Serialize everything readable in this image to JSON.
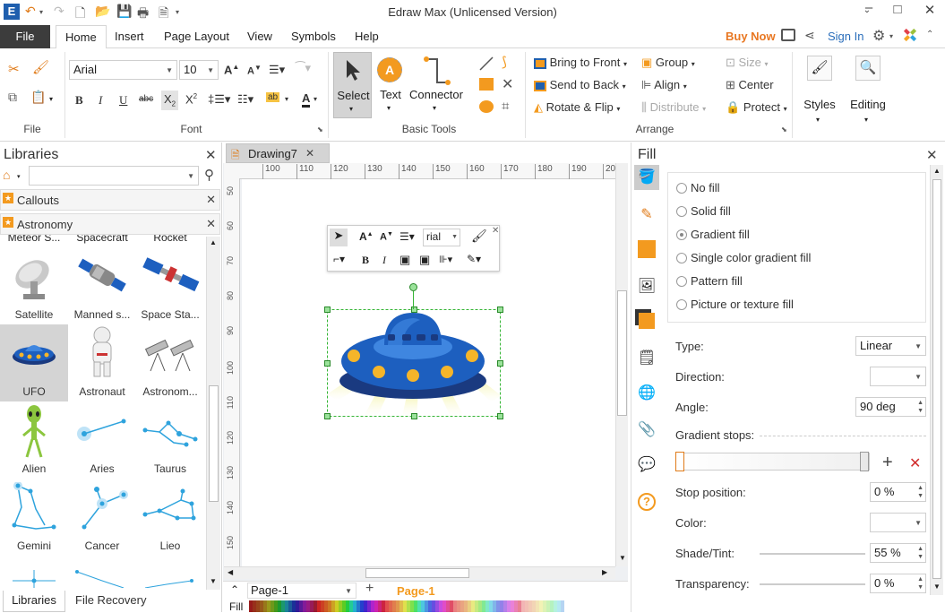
{
  "app": {
    "title": "Edraw Max (Unlicensed Version)"
  },
  "tabs": [
    "File",
    "Home",
    "Insert",
    "Page Layout",
    "View",
    "Symbols",
    "Help"
  ],
  "header_right": {
    "buy_now": "Buy Now",
    "sign_in": "Sign In"
  },
  "font": {
    "name": "Arial",
    "size": "10"
  },
  "groups": {
    "file": "File",
    "font": "Font",
    "basic_tools": "Basic Tools",
    "arrange": "Arrange"
  },
  "tools": {
    "select": "Select",
    "text": "Text",
    "connector": "Connector"
  },
  "arrange": {
    "bring_to_front": "Bring to Front",
    "send_to_back": "Send to Back",
    "rotate_flip": "Rotate & Flip",
    "group": "Group",
    "align": "Align",
    "distribute": "Distribute",
    "size": "Size",
    "center": "Center",
    "protect": "Protect"
  },
  "styles_label": "Styles",
  "editing_label": "Editing",
  "libraries": {
    "title": "Libraries",
    "rows": [
      "Callouts",
      "Astronomy"
    ],
    "partial_labels": [
      "Meteor S...",
      "Spacecraft",
      "Rocket"
    ],
    "items": [
      "Satellite",
      "Manned s...",
      "Space Sta...",
      "UFO",
      "Astronaut",
      "Astronom...",
      "Alien",
      "Aries",
      "Taurus",
      "Gemini",
      "Cancer",
      "Lieo"
    ],
    "bottom_tabs": [
      "Libraries",
      "File Recovery"
    ]
  },
  "document": {
    "tab": "Drawing7",
    "page_tab": "Page-1",
    "page_label": "Page-1",
    "fill_label": "Fill",
    "ruler_h": [
      "100",
      "110",
      "120",
      "130",
      "140",
      "150",
      "160",
      "170",
      "180",
      "190",
      "200"
    ],
    "ruler_v": [
      "50",
      "60",
      "70",
      "80",
      "90",
      "100",
      "110",
      "120",
      "130",
      "140",
      "150"
    ],
    "mini_font": "rial"
  },
  "fill_panel": {
    "title": "Fill",
    "options": [
      "No fill",
      "Solid fill",
      "Gradient fill",
      "Single color gradient fill",
      "Pattern fill",
      "Picture or texture fill"
    ],
    "selected": "Gradient fill",
    "type_label": "Type:",
    "type_value": "Linear",
    "direction_label": "Direction:",
    "angle_label": "Angle:",
    "angle_value": "90 deg",
    "gradient_stops_label": "Gradient stops:",
    "stop_position_label": "Stop position:",
    "stop_position_value": "0 %",
    "color_label": "Color:",
    "shade_label": "Shade/Tint:",
    "shade_value": "55 %",
    "transparency_label": "Transparency:",
    "transparency_value": "0 %"
  },
  "colors": {
    "accent": "#2a6ebb",
    "orange": "#f39a1f",
    "buy_now": "#e87722",
    "ufo_dark": "#1a3a80",
    "ufo_mid": "#1d5fbf",
    "ufo_light": "#3f86e0",
    "ufo_yellow": "#f5b52a"
  }
}
